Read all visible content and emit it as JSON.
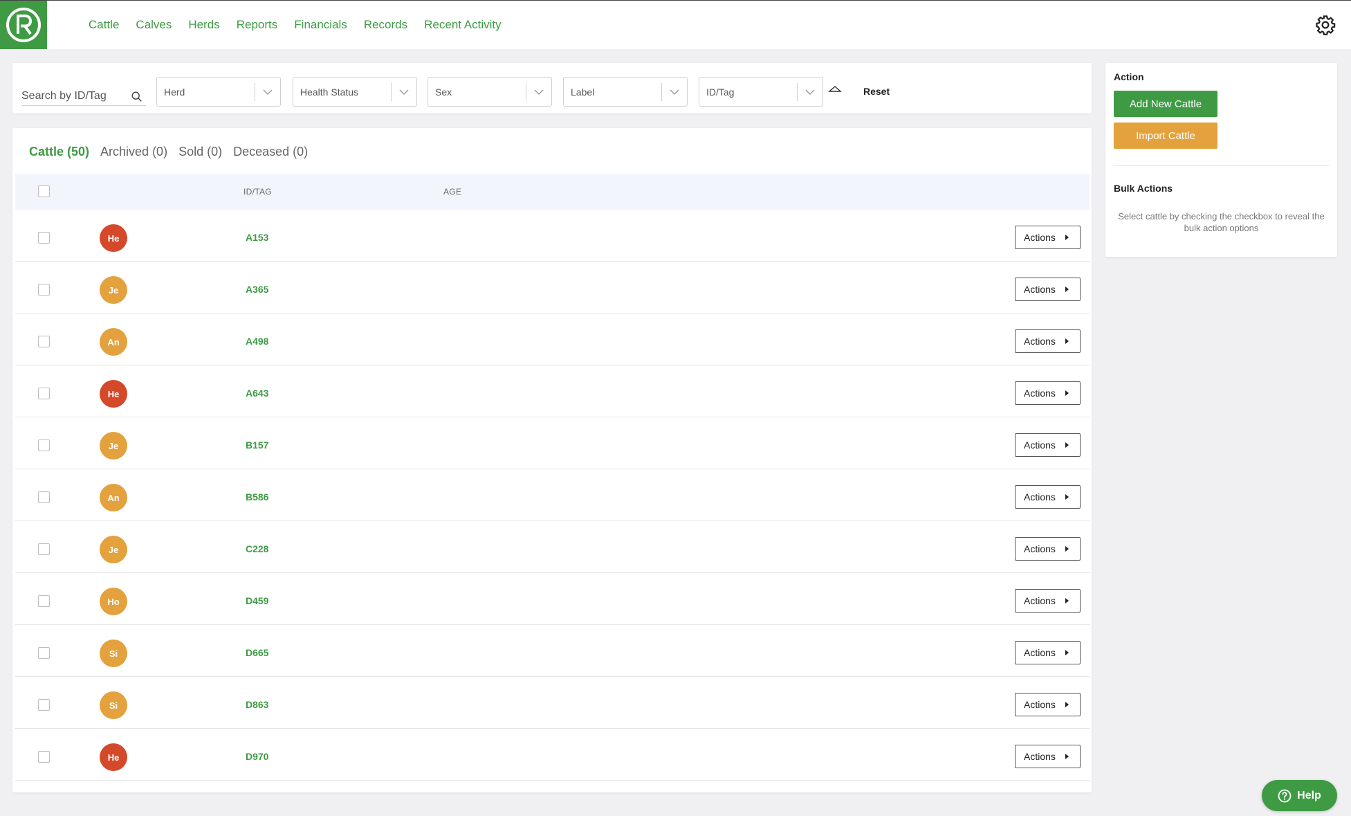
{
  "nav": {
    "items": [
      "Cattle",
      "Calves",
      "Herds",
      "Reports",
      "Financials",
      "Records",
      "Recent Activity"
    ]
  },
  "filters": {
    "search_placeholder": "Search by ID/Tag",
    "herd": "Herd",
    "health_status": "Health Status",
    "sex": "Sex",
    "label": "Label",
    "id_tag": "ID/Tag",
    "reset": "Reset"
  },
  "tabs": [
    {
      "label": "Cattle (50)",
      "active": true
    },
    {
      "label": "Archived (0)",
      "active": false
    },
    {
      "label": "Sold (0)",
      "active": false
    },
    {
      "label": "Deceased (0)",
      "active": false
    }
  ],
  "table": {
    "headers": {
      "id_tag": "ID/TAG",
      "age": "AGE"
    },
    "action_label": "Actions",
    "rows": [
      {
        "initials": "He",
        "color": "#d4492a",
        "tag": "A153"
      },
      {
        "initials": "Je",
        "color": "#e3a23d",
        "tag": "A365"
      },
      {
        "initials": "An",
        "color": "#e3a23d",
        "tag": "A498"
      },
      {
        "initials": "He",
        "color": "#d4492a",
        "tag": "A643"
      },
      {
        "initials": "Je",
        "color": "#e3a23d",
        "tag": "B157"
      },
      {
        "initials": "An",
        "color": "#e3a23d",
        "tag": "B586"
      },
      {
        "initials": "Je",
        "color": "#e3a23d",
        "tag": "C228"
      },
      {
        "initials": "Ho",
        "color": "#e3a23d",
        "tag": "D459"
      },
      {
        "initials": "Si",
        "color": "#e3a23d",
        "tag": "D665"
      },
      {
        "initials": "Si",
        "color": "#e3a23d",
        "tag": "D863"
      },
      {
        "initials": "He",
        "color": "#d4492a",
        "tag": "D970"
      }
    ]
  },
  "side": {
    "action_title": "Action",
    "add_button": "Add New Cattle",
    "import_button": "Import Cattle",
    "bulk_title": "Bulk Actions",
    "bulk_text": "Select cattle by checking the checkbox to reveal the bulk action options"
  },
  "help": {
    "label": "Help"
  }
}
